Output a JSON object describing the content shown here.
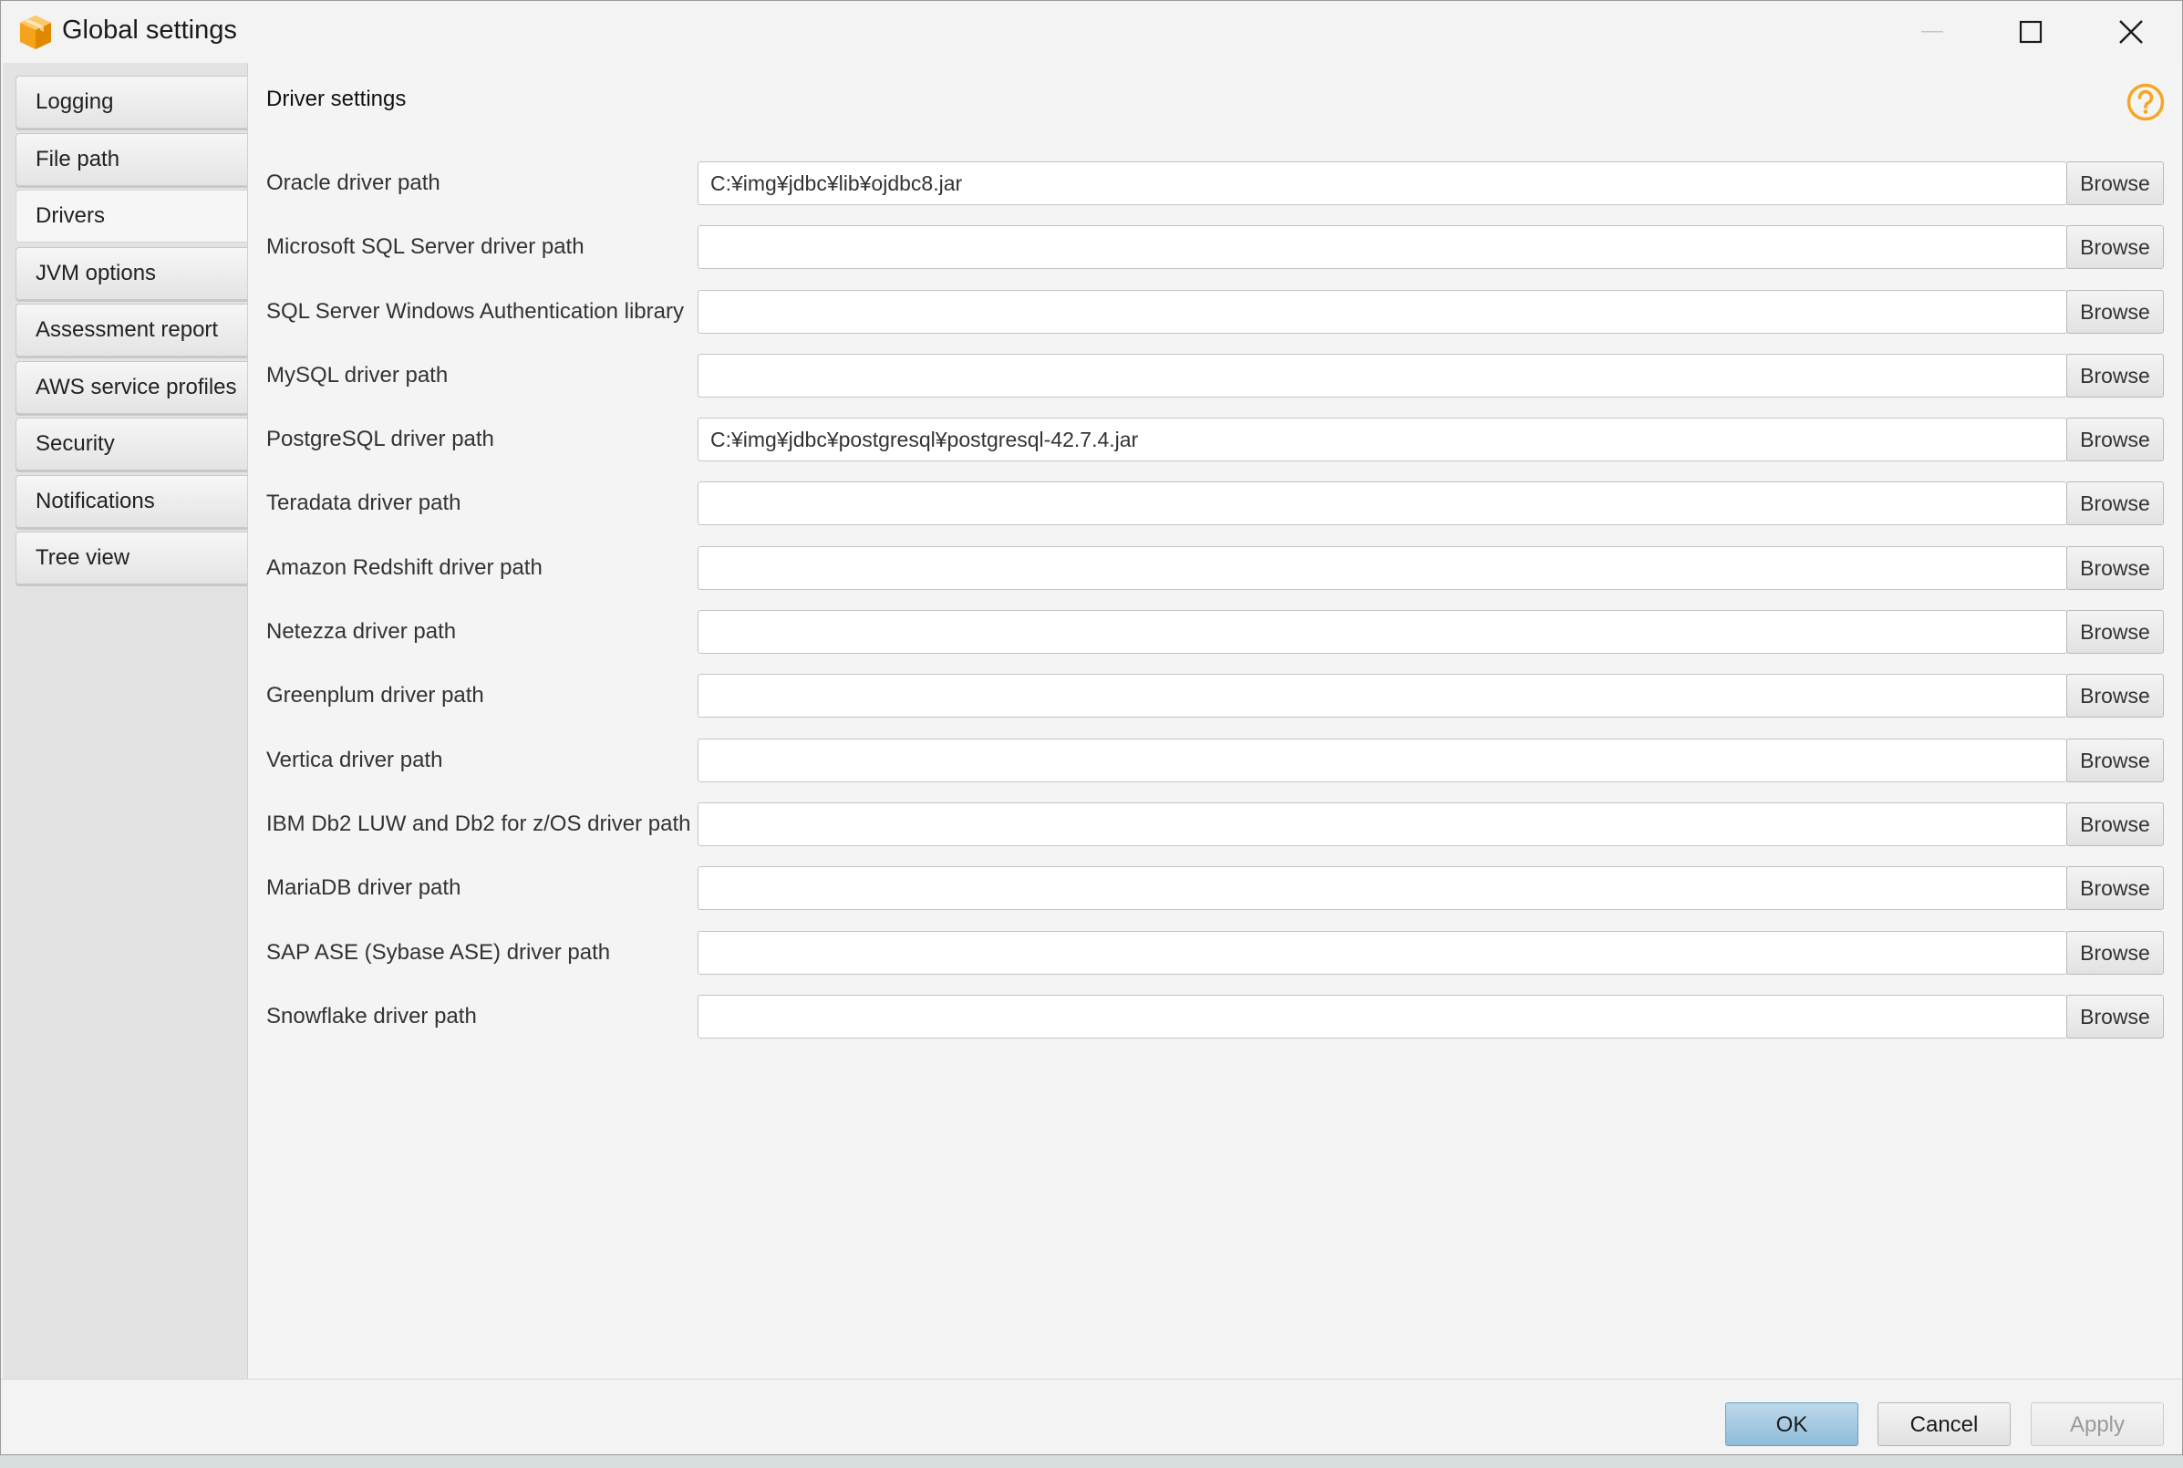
{
  "window": {
    "title": "Global settings"
  },
  "sidebar": {
    "items": [
      {
        "label": "Logging",
        "active": false
      },
      {
        "label": "File path",
        "active": false
      },
      {
        "label": "Drivers",
        "active": true
      },
      {
        "label": "JVM options",
        "active": false
      },
      {
        "label": "Assessment report",
        "active": false
      },
      {
        "label": "AWS service profiles",
        "active": false
      },
      {
        "label": "Security",
        "active": false
      },
      {
        "label": "Notifications",
        "active": false
      },
      {
        "label": "Tree view",
        "active": false
      }
    ]
  },
  "main": {
    "section_title": "Driver settings",
    "browse_label": "Browse",
    "rows": [
      {
        "label": "Oracle driver path",
        "value": "C:¥img¥jdbc¥lib¥ojdbc8.jar"
      },
      {
        "label": "Microsoft SQL Server driver path",
        "value": ""
      },
      {
        "label": "SQL Server Windows Authentication library",
        "value": ""
      },
      {
        "label": "MySQL driver path",
        "value": ""
      },
      {
        "label": "PostgreSQL driver path",
        "value": "C:¥img¥jdbc¥postgresql¥postgresql-42.7.4.jar"
      },
      {
        "label": "Teradata driver path",
        "value": ""
      },
      {
        "label": "Amazon Redshift driver path",
        "value": ""
      },
      {
        "label": "Netezza driver path",
        "value": ""
      },
      {
        "label": "Greenplum driver path",
        "value": ""
      },
      {
        "label": "Vertica driver path",
        "value": ""
      },
      {
        "label": "IBM Db2 LUW and Db2 for z/OS driver path",
        "value": ""
      },
      {
        "label": "MariaDB driver path",
        "value": ""
      },
      {
        "label": "SAP ASE (Sybase ASE) driver path",
        "value": ""
      },
      {
        "label": "Snowflake driver path",
        "value": ""
      }
    ]
  },
  "footer": {
    "ok_label": "OK",
    "cancel_label": "Cancel",
    "apply_label": "Apply"
  },
  "colors": {
    "accent": "#f5a623",
    "ok_button": "#a9cde5"
  },
  "icons": {
    "app": "aws-cube-icon",
    "help": "help-icon",
    "minimize": "minimize-icon",
    "maximize": "maximize-icon",
    "close": "close-icon"
  }
}
